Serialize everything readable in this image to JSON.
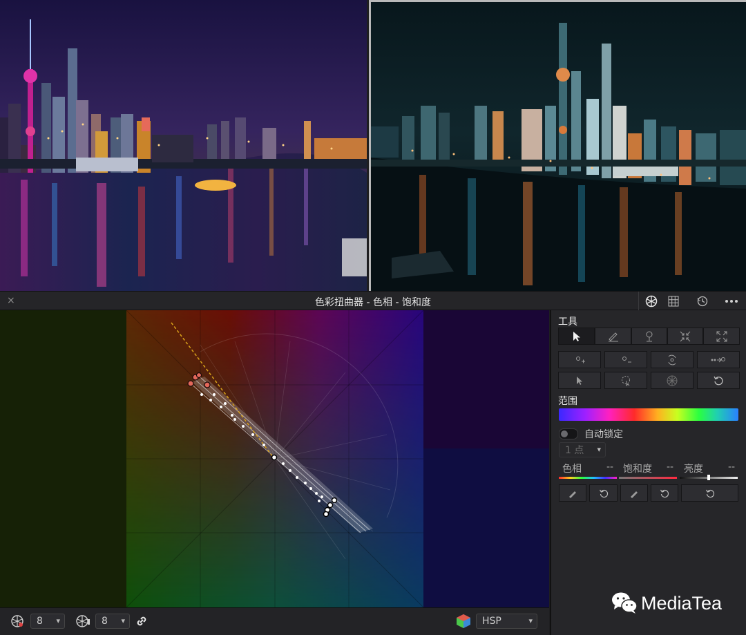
{
  "panel": {
    "title": "色彩扭曲器 - 色相 - 饱和度",
    "close_icon": "×"
  },
  "header_icons": [
    "warper-icon",
    "grid-icon",
    "history-icon",
    "more-icon"
  ],
  "side": {
    "tools_label": "工具",
    "range_label": "范围",
    "auto_lock_label": "自动锁定",
    "points_select": "1 点",
    "hue_label": "色相",
    "hue_value": "--",
    "sat_label": "饱和度",
    "sat_value": "--",
    "lum_label": "亮度",
    "lum_value": "--"
  },
  "bottom": {
    "res1": "8",
    "res2": "8",
    "color_space": "HSP"
  },
  "watermark": {
    "text": "MediaTea"
  },
  "colors": {
    "panel_bg": "#262629",
    "accent_dashed": "#d9a21a",
    "control_point": "#e4685a"
  }
}
